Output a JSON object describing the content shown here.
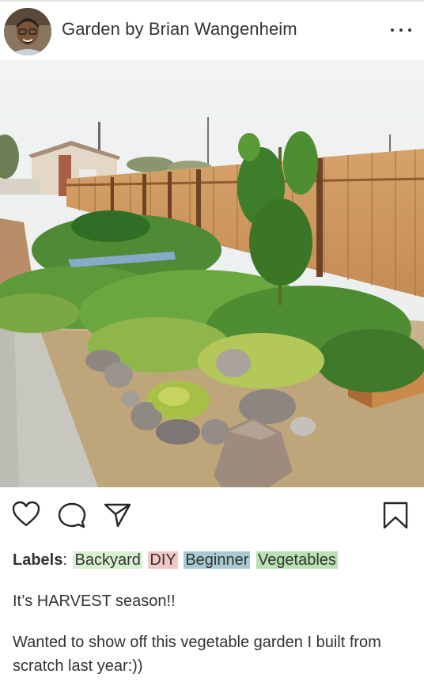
{
  "post": {
    "title": "Garden by Brian Wangenheim",
    "labels_key": "Labels",
    "labels_sep": ":",
    "labels": [
      "Backyard",
      "DIY",
      "Beginner",
      "Vegetables"
    ],
    "caption_line1": "It’s HARVEST season!!",
    "caption_line2": "Wanted to show off this vegetable garden I built from scratch last year:))"
  },
  "icons": {
    "more": "more-options-icon",
    "like": "heart-icon",
    "comment": "comment-bubble-icon",
    "share": "paper-plane-icon",
    "save": "bookmark-icon"
  },
  "colors": {
    "tag_backyard": "#d6f1cf",
    "tag_diy": "#f3c7c3",
    "tag_beginner": "#a9cad3",
    "tag_vegetables": "#b9e1b2"
  }
}
